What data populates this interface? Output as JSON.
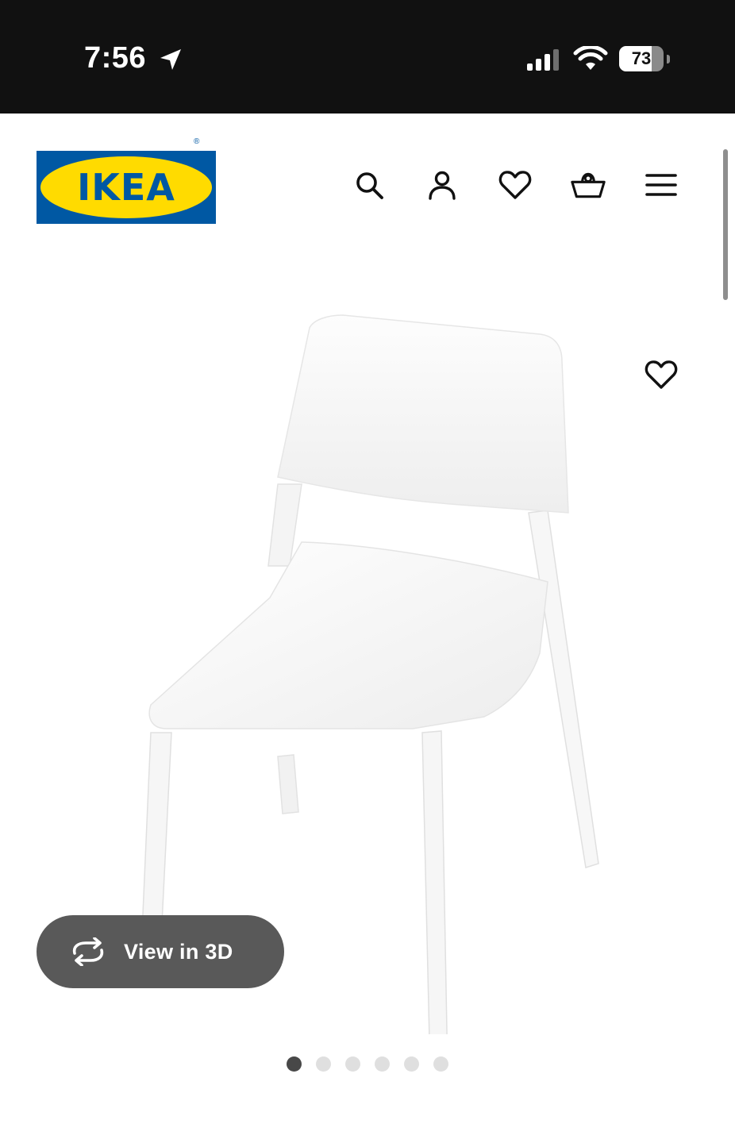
{
  "status_bar": {
    "time": "7:56",
    "battery_level": "73",
    "battery_fraction": 0.73,
    "icons": [
      "location-arrow-icon",
      "cellular-signal-icon",
      "wifi-icon",
      "battery-icon"
    ]
  },
  "header": {
    "logo_text": "IKEA",
    "logo_registered": "®",
    "icons": [
      "search-icon",
      "account-icon",
      "heart-icon",
      "shopping-basket-icon",
      "hamburger-menu-icon"
    ]
  },
  "gallery": {
    "favorite_icon": "heart-outline-icon",
    "view_3d_label": "View in 3D",
    "view_3d_icon": "rotate-arrows-icon",
    "slide_count": 6,
    "active_slide": 1
  },
  "colors": {
    "ikea_blue": "#0058a3",
    "ikea_yellow": "#ffdb00",
    "status_bar_bg": "#111111",
    "button_bg": "#595959",
    "dot_active": "#484848",
    "dot_inactive": "#dfdfdf"
  }
}
